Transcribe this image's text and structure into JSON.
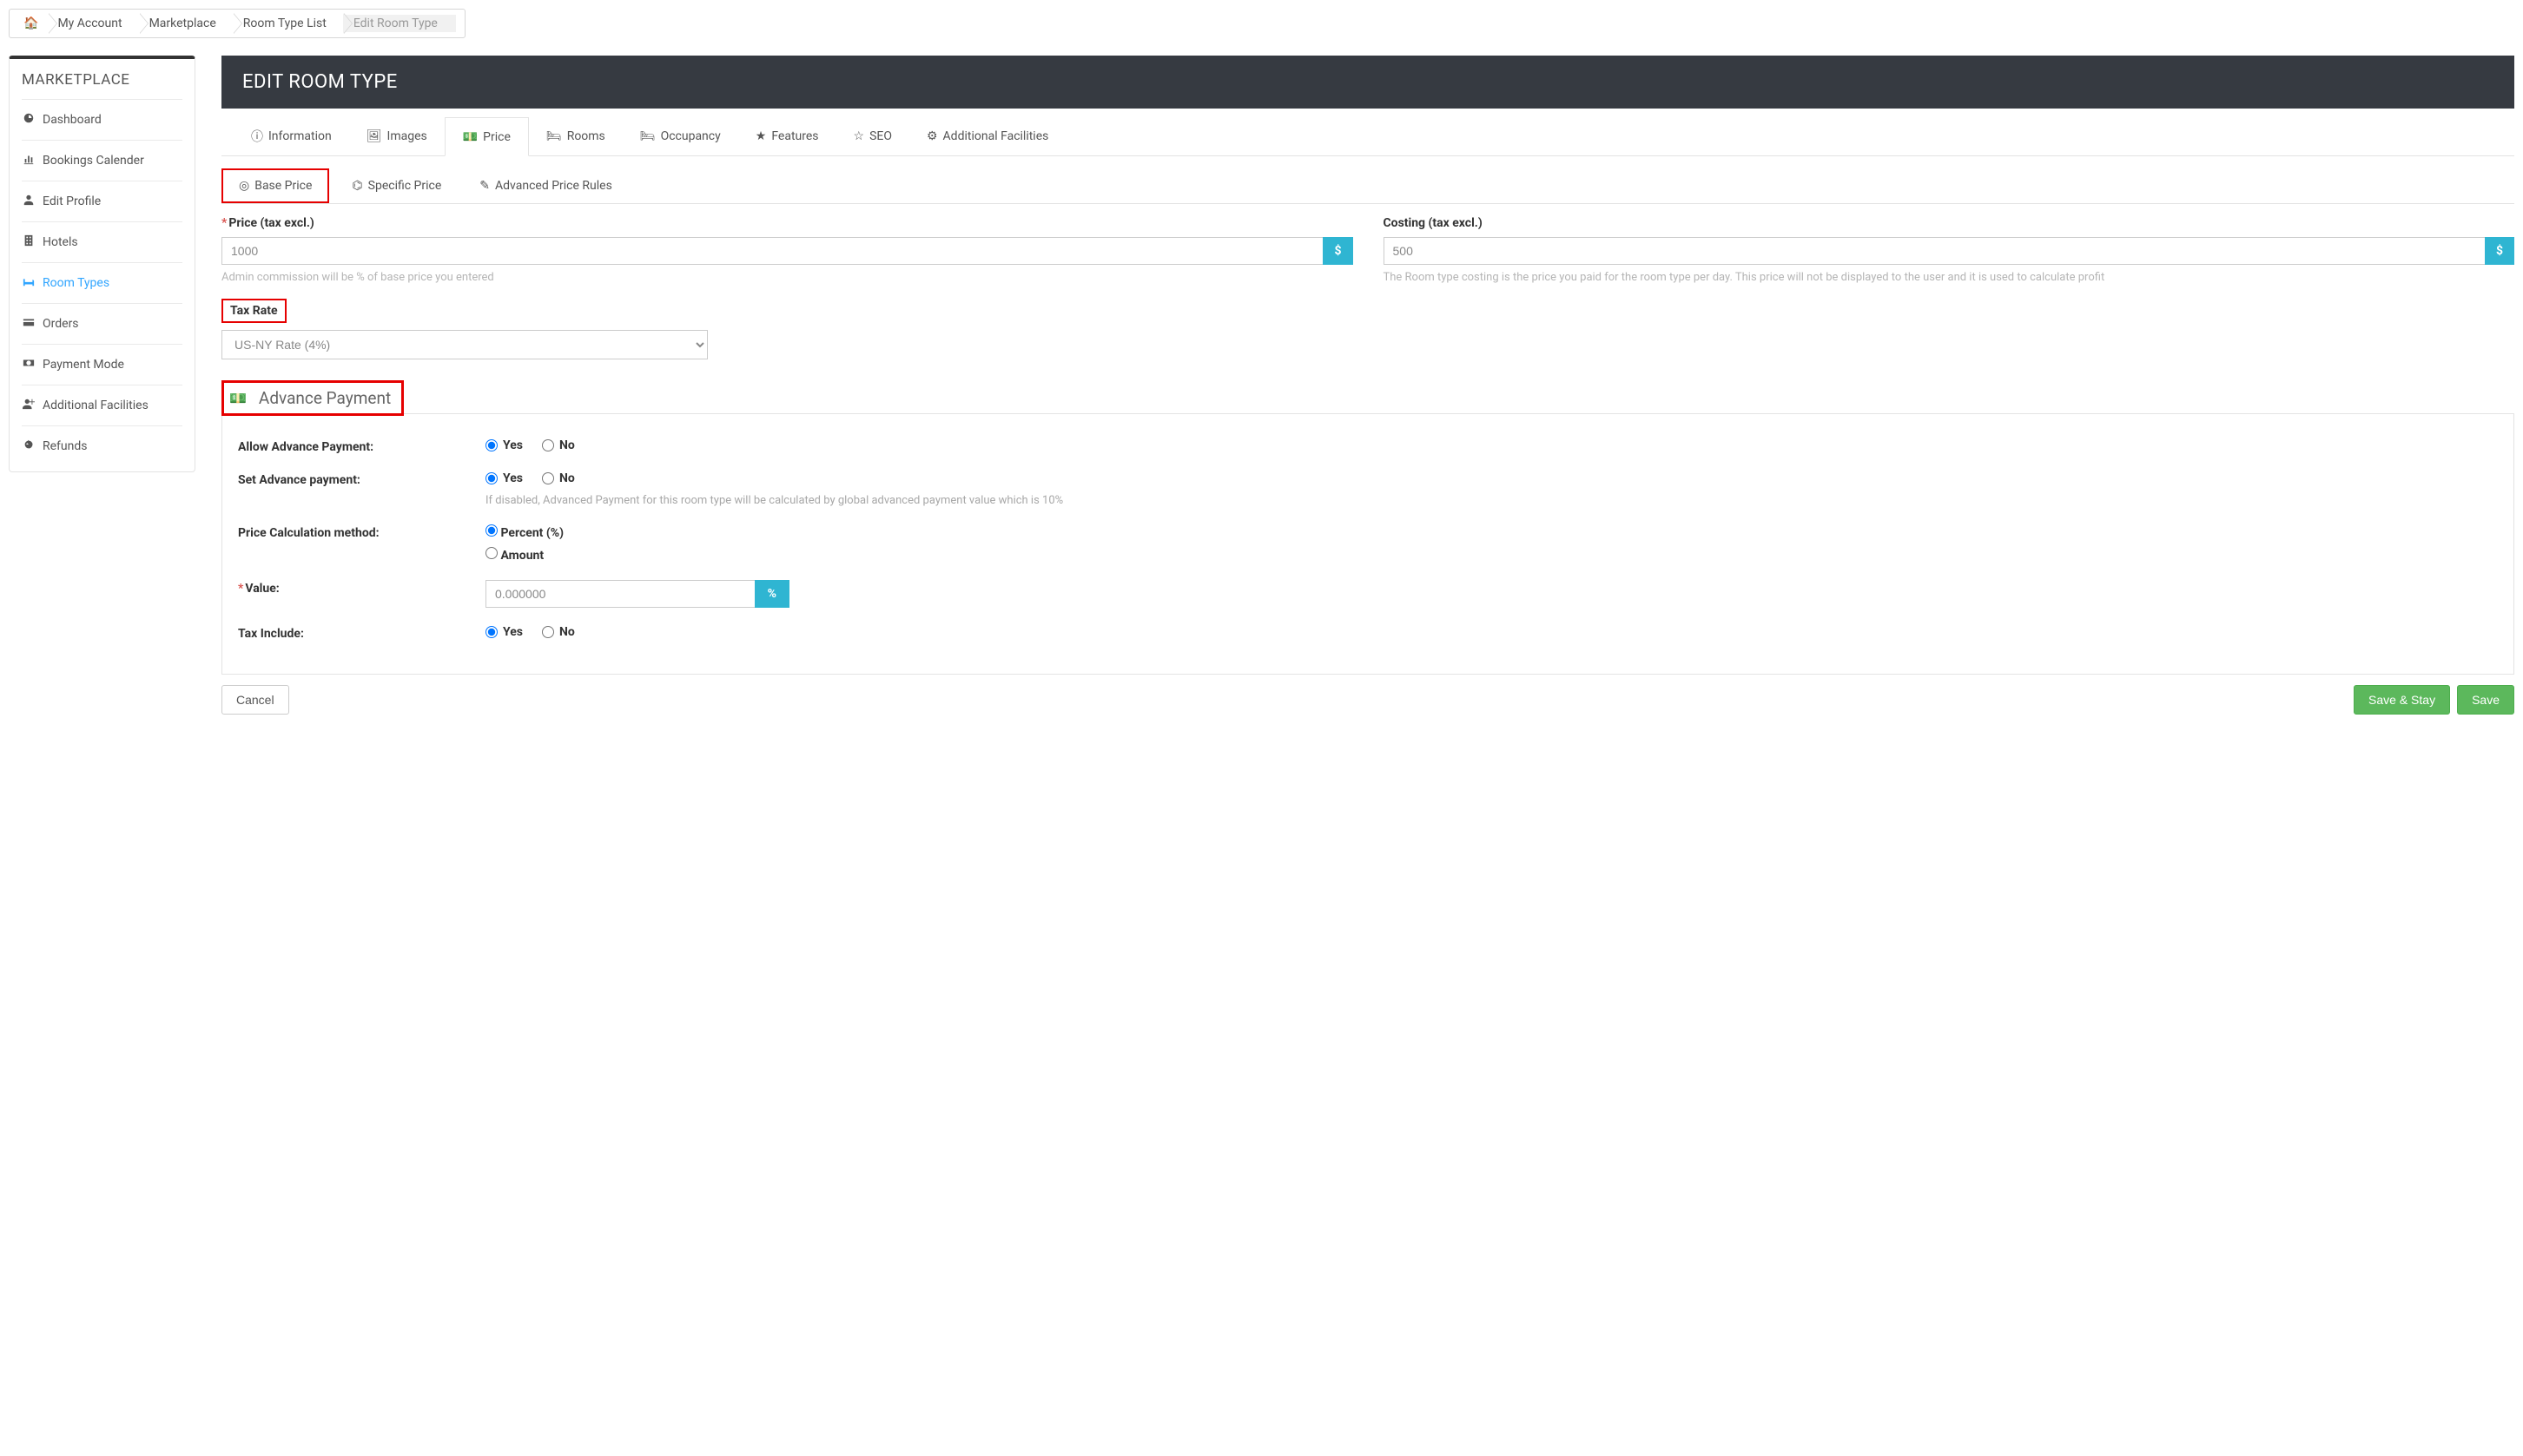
{
  "breadcrumb": {
    "myAccount": "My Account",
    "marketplace": "Marketplace",
    "roomTypeList": "Room Type List",
    "current": "Edit Room Type"
  },
  "sidebar": {
    "title": "MARKETPLACE",
    "items": {
      "dashboard": "Dashboard",
      "bookings": "Bookings Calender",
      "editProfile": "Edit Profile",
      "hotels": "Hotels",
      "roomTypes": "Room Types",
      "orders": "Orders",
      "paymentMode": "Payment Mode",
      "additionalFacilities": "Additional Facilities",
      "refunds": "Refunds"
    }
  },
  "header": {
    "title": "EDIT ROOM TYPE"
  },
  "tabs": {
    "information": "Information",
    "images": "Images",
    "price": "Price",
    "rooms": "Rooms",
    "occupancy": "Occupancy",
    "features": "Features",
    "seo": "SEO",
    "additional": "Additional Facilities"
  },
  "subtabs": {
    "base": "Base Price",
    "specific": "Specific Price",
    "advanced": "Advanced Price Rules"
  },
  "price": {
    "label": "Price (tax excl.)",
    "value": "1000",
    "currency": "$",
    "hint": "Admin commission will be % of base price you entered"
  },
  "costing": {
    "label": "Costing (tax excl.)",
    "value": "500",
    "currency": "$",
    "hint": "The Room type costing is the price you paid for the room type per day. This price will not be displayed to the user and it is used to calculate profit"
  },
  "tax": {
    "label": "Tax Rate",
    "selected": "US-NY Rate (4%)"
  },
  "advance": {
    "title": "Advance Payment",
    "allowLabel": "Allow Advance Payment:",
    "setLabel": "Set Advance payment:",
    "setHint": "If disabled, Advanced Payment for this room type will be calculated by global advanced payment value which is 10%",
    "calcLabel": "Price Calculation method:",
    "valueLabel": "Value:",
    "valueVal": "0.000000",
    "valueUnit": "%",
    "taxIncLabel": "Tax Include:",
    "optYes": "Yes",
    "optNo": "No",
    "optPercent": "Percent (%)",
    "optAmount": "Amount"
  },
  "actions": {
    "cancel": "Cancel",
    "saveStay": "Save & Stay",
    "save": "Save"
  }
}
